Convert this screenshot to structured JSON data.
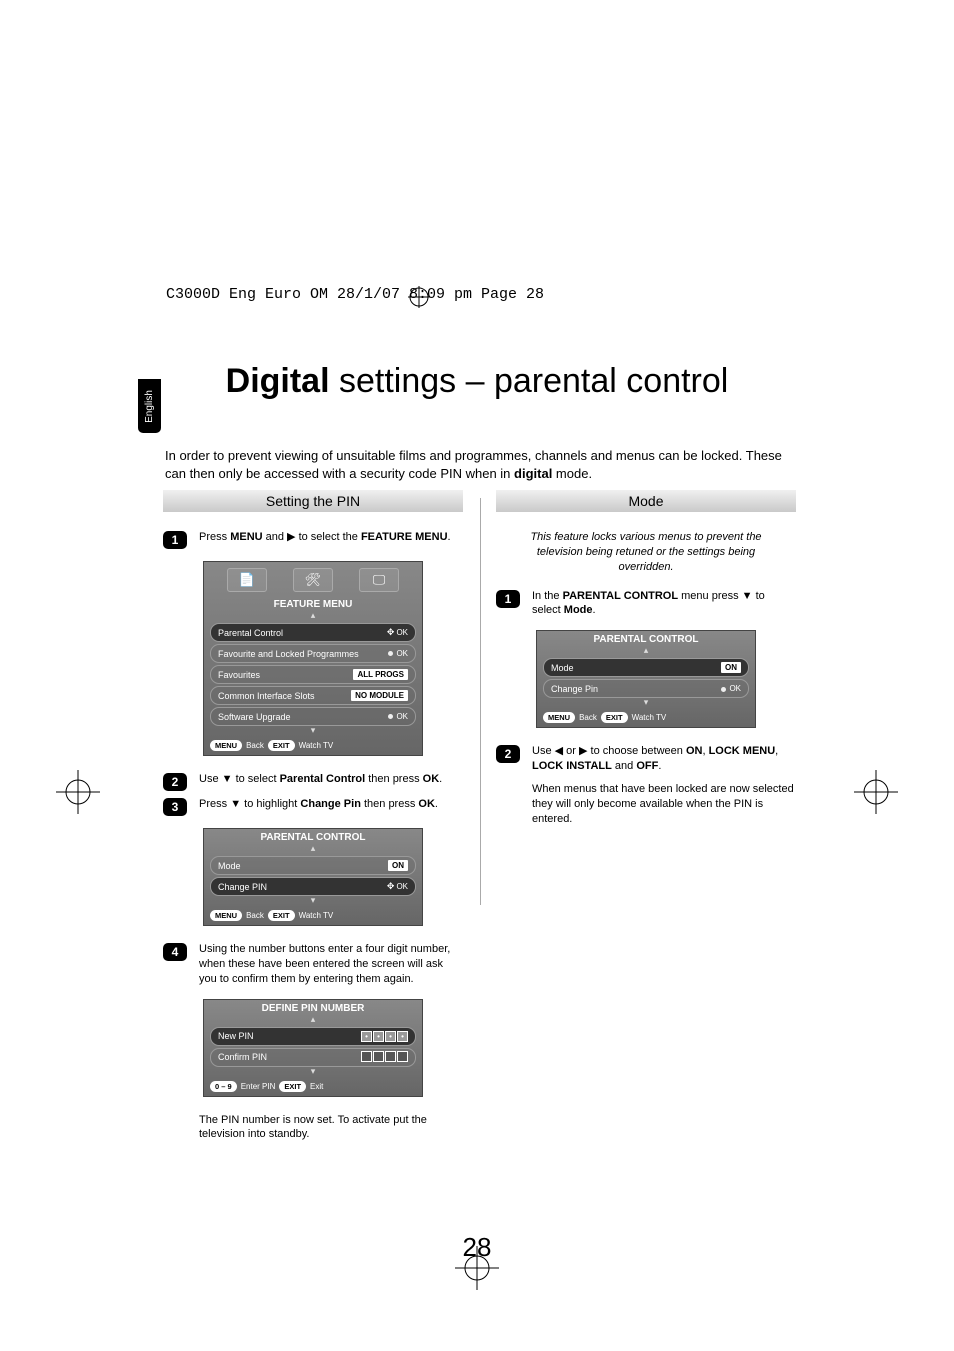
{
  "header_line": "C3000D Eng Euro OM  28/1/07  8:09 pm  Page 28",
  "sidebar_lang": "English",
  "title_bold": "Digital",
  "title_rest": " settings – parental control",
  "intro": {
    "t1": "In order to prevent viewing of unsuitable films and programmes, channels and menus can be locked. These can then only be accessed with a security code PIN when in ",
    "b1": "digital",
    "t2": " mode."
  },
  "left": {
    "section": "Setting the PIN",
    "step1": {
      "a": "Press ",
      "b": "MENU",
      "c": " and ",
      "icon": "▶",
      "d": " to select the ",
      "e": "FEATURE MENU",
      "f": "."
    },
    "osd1": {
      "title": "FEATURE MENU",
      "rows": [
        {
          "label": "Parental Control",
          "hint_joy": true,
          "hint": "OK"
        },
        {
          "label": "Favourite and Locked Programmes",
          "hint_dot": true,
          "hint": "OK"
        },
        {
          "label": "Favourites",
          "val": "ALL PROGS"
        },
        {
          "label": "Common Interface Slots",
          "val": "NO MODULE"
        },
        {
          "label": "Software Upgrade",
          "hint_dot": true,
          "hint": "OK"
        }
      ],
      "footer": {
        "b1": "MENU",
        "l1": "Back",
        "b2": "EXIT",
        "l2": "Watch TV"
      }
    },
    "step2": {
      "a": "Use ",
      "icon": "▼",
      "b": " to select ",
      "c": "Parental Control",
      "d": " then press ",
      "e": "OK",
      "f": "."
    },
    "step3": {
      "a": "Press ",
      "icon": "▼",
      "b": " to highlight ",
      "c": "Change Pin",
      "d": " then press ",
      "e": "OK",
      "f": "."
    },
    "osd2": {
      "title": "PARENTAL CONTROL",
      "rows": [
        {
          "label": "Mode",
          "val": "ON"
        },
        {
          "label": "Change PIN",
          "hint_joy": true,
          "hint": "OK"
        }
      ],
      "footer": {
        "b1": "MENU",
        "l1": "Back",
        "b2": "EXIT",
        "l2": "Watch TV"
      }
    },
    "step4": "Using the number buttons enter a four digit number, when these have been entered the screen will ask you to confirm them by entering them again.",
    "osd3": {
      "title": "DEFINE PIN NUMBER",
      "rows": [
        {
          "label": "New PIN",
          "pin": "dots"
        },
        {
          "label": "Confirm PIN",
          "pin": "open"
        }
      ],
      "footer": {
        "b1": "0 – 9",
        "l1": "Enter PIN",
        "b2": "EXIT",
        "l2": "Exit"
      }
    },
    "end_note": "The PIN number is now set. To activate put the television into standby."
  },
  "right": {
    "section": "Mode",
    "intro_ital": "This feature locks various menus to prevent the television being retuned or the settings being overridden.",
    "step1": {
      "a": "In the ",
      "b": "PARENTAL CONTROL",
      "c": " menu press ",
      "icon": "▼",
      "d": " to select ",
      "e": "Mode",
      "f": "."
    },
    "osd": {
      "title": "PARENTAL CONTROL",
      "rows": [
        {
          "label": "Mode",
          "val": "ON"
        },
        {
          "label": "Change Pin",
          "hint_dot": true,
          "hint": "OK"
        }
      ],
      "footer": {
        "b1": "MENU",
        "l1": "Back",
        "b2": "EXIT",
        "l2": "Watch TV"
      }
    },
    "step2": {
      "a": "Use ",
      "i1": "◀",
      "b": " or ",
      "i2": "▶",
      "c": " to choose between ",
      "d": "ON",
      "e": ", ",
      "f": "LOCK MENU",
      "g": ", ",
      "h": "LOCK INSTALL",
      "i": " and ",
      "j": "OFF",
      "k": "."
    },
    "end_note": "When menus that have been locked are now selected they will only become available when the PIN is entered."
  },
  "page_number": "28"
}
